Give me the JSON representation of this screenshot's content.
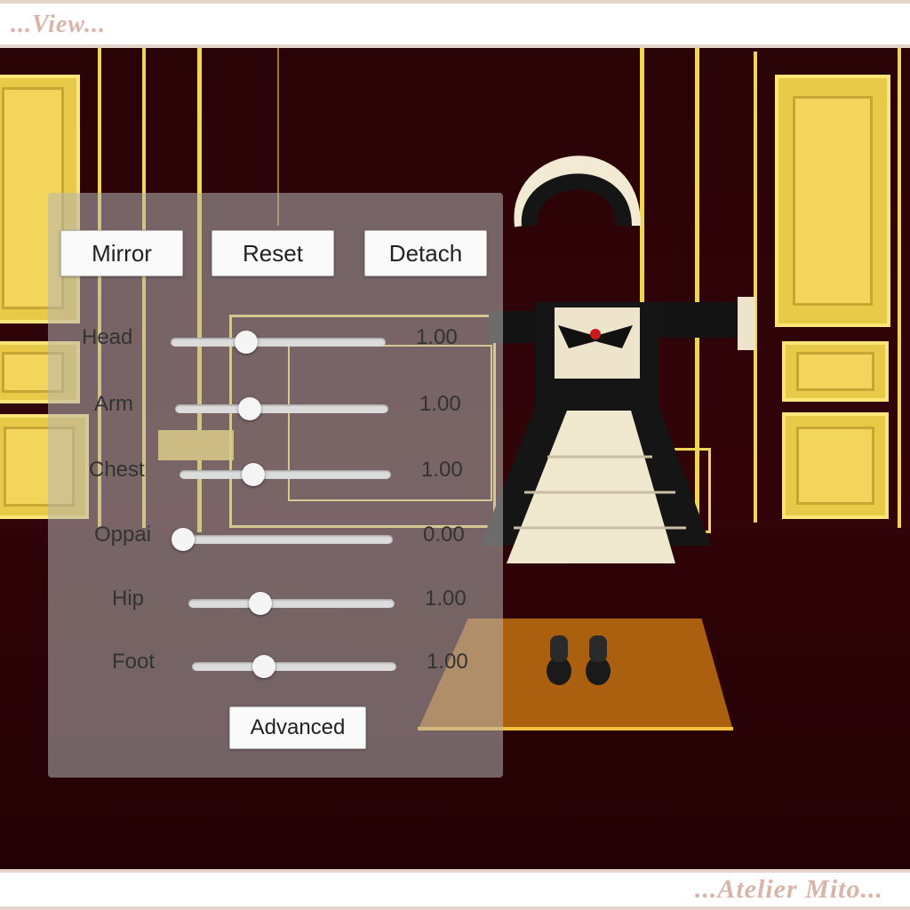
{
  "header": {
    "title": "...View..."
  },
  "footer": {
    "brand": "...Atelier Mito..."
  },
  "controls": {
    "buttons": {
      "mirror": "Mirror",
      "reset": "Reset",
      "detach": "Detach",
      "advanced": "Advanced"
    },
    "sliders": [
      {
        "label": "Head",
        "value": 1.0,
        "display": "1.00"
      },
      {
        "label": "Arm",
        "value": 1.0,
        "display": "1.00"
      },
      {
        "label": "Chest",
        "value": 1.0,
        "display": "1.00"
      },
      {
        "label": "Oppai",
        "value": 0.0,
        "display": "0.00"
      },
      {
        "label": "Hip",
        "value": 1.0,
        "display": "1.00"
      },
      {
        "label": "Foot",
        "value": 1.0,
        "display": "1.00"
      }
    ]
  },
  "colors": {
    "wall": "#2a0306",
    "gold": "#f0d458",
    "accent_band": "#e6d3cc",
    "brand_text": "#d8b5a8"
  },
  "icons": {
    "dress": "maid-dress-icon",
    "shoes": "shoes-icon"
  }
}
